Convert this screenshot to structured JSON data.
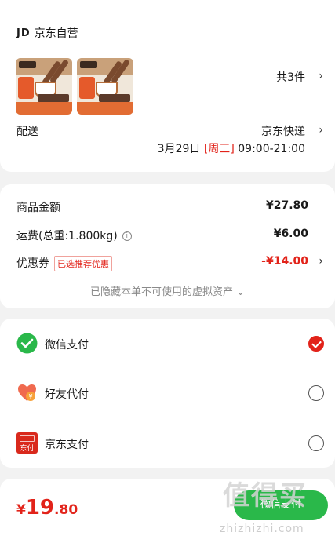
{
  "shop": {
    "logo": "JD",
    "name": "京东自营"
  },
  "items": {
    "count_text": "共3件"
  },
  "delivery": {
    "label": "配送",
    "method": "京东快递",
    "date": "3月29日",
    "weekday": "[周三]",
    "time": "09:00-21:00"
  },
  "price": {
    "goods_label": "商品金额",
    "goods_value": "¥27.80",
    "shipping_label": "运费(总重:1.800kg)",
    "shipping_value": "¥6.00",
    "coupon_label": "优惠券",
    "coupon_tag": "已选推荐优惠",
    "coupon_value": "-¥14.00",
    "hidden_note": "已隐藏本单不可使用的虚拟资产 ⌄"
  },
  "payment": {
    "options": [
      {
        "label": "微信支付",
        "checked": true,
        "icon": "wechat-pay-icon"
      },
      {
        "label": "好友代付",
        "checked": false,
        "icon": "friend-pay-icon"
      },
      {
        "label": "京东支付",
        "checked": false,
        "icon": "jd-pay-icon"
      }
    ],
    "jd_icon_text": "东付"
  },
  "footer": {
    "currency": "¥",
    "total_int": "19",
    "total_dec": ".80",
    "submit_label": "微信支付"
  },
  "watermark": {
    "big": "值得买",
    "small": "zhizhizhi.com"
  },
  "colors": {
    "accent": "#e2231a",
    "wechat": "#2ab84a",
    "background": "#f2f2f2"
  }
}
